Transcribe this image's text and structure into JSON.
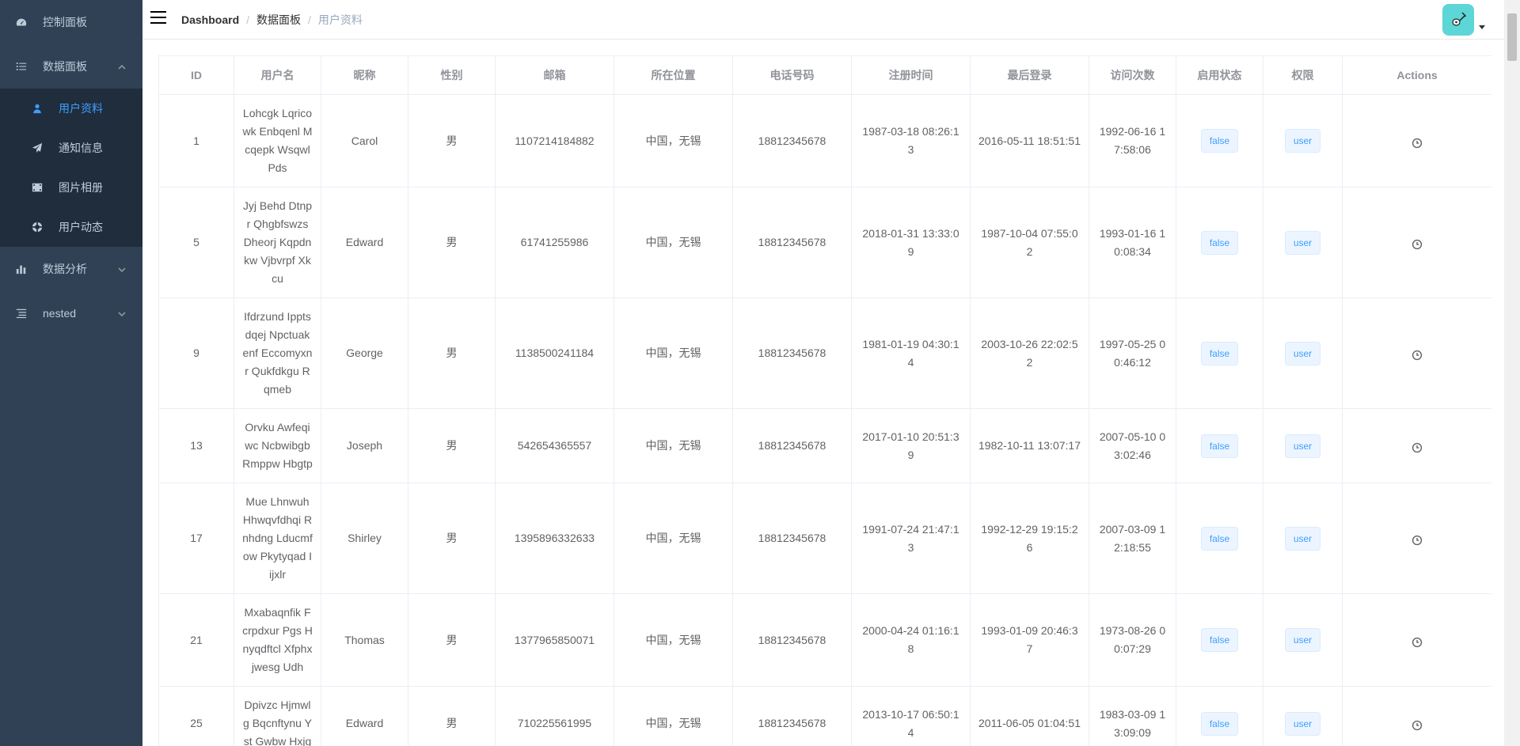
{
  "sidebar": {
    "items": [
      {
        "label": "控制面板",
        "icon": "dashboard-icon"
      },
      {
        "label": "数据面板",
        "icon": "list-icon",
        "expanded": true,
        "children": [
          {
            "label": "用户资料",
            "icon": "user-icon",
            "active": true
          },
          {
            "label": "通知信息",
            "icon": "send-icon"
          },
          {
            "label": "图片相册",
            "icon": "film-icon"
          },
          {
            "label": "用户动态",
            "icon": "lifebuoy-icon"
          }
        ]
      },
      {
        "label": "数据分析",
        "icon": "bar-chart-icon"
      },
      {
        "label": "nested",
        "icon": "nested-list-icon"
      }
    ]
  },
  "navbar": {
    "breadcrumb": [
      "Dashboard",
      "数据面板",
      "用户资料"
    ],
    "separator": "/"
  },
  "table": {
    "columns": [
      "ID",
      "用户名",
      "昵称",
      "性别",
      "邮箱",
      "所在位置",
      "电话号码",
      "注册时间",
      "最后登录",
      "访问次数",
      "启用状态",
      "权限",
      "Actions"
    ],
    "rows": [
      {
        "id": "1",
        "username": "Lohcgk Lqricowk Enbqenl Mcqepk Wsqwl Pds",
        "nickname": "Carol",
        "gender": "男",
        "email": "1107214184882",
        "location": "中国，无锡",
        "phone": "18812345678",
        "registered": "1987-03-18 08:26:13",
        "last_login": "2016-05-11 18:51:51",
        "visits": "1992-06-16 17:58:06",
        "status": "false",
        "role": "user"
      },
      {
        "id": "5",
        "username": "Jyj Behd Dtnpr Qhgbfswzs Dheorj Kqpdnkw Vjbvrpf Xkcu",
        "nickname": "Edward",
        "gender": "男",
        "email": "61741255986",
        "location": "中国，无锡",
        "phone": "18812345678",
        "registered": "2018-01-31 13:33:09",
        "last_login": "1987-10-04 07:55:02",
        "visits": "1993-01-16 10:08:34",
        "status": "false",
        "role": "user"
      },
      {
        "id": "9",
        "username": "Ifdrzund Ippts dqej Npctuakenf Eccomyxnr Qukfdkgu Rqmeb",
        "nickname": "George",
        "gender": "男",
        "email": "1138500241184",
        "location": "中国，无锡",
        "phone": "18812345678",
        "registered": "1981-01-19 04:30:14",
        "last_login": "2003-10-26 22:02:52",
        "visits": "1997-05-25 00:46:12",
        "status": "false",
        "role": "user"
      },
      {
        "id": "13",
        "username": "Orvku Awfeqiwc Ncbwibgb Rmppw Hbgtp",
        "nickname": "Joseph",
        "gender": "男",
        "email": "542654365557",
        "location": "中国，无锡",
        "phone": "18812345678",
        "registered": "2017-01-10 20:51:39",
        "last_login": "1982-10-11 13:07:17",
        "visits": "2007-05-10 03:02:46",
        "status": "false",
        "role": "user"
      },
      {
        "id": "17",
        "username": "Mue Lhnwuh Hhwqvfdhqi Rnhdng Lducmfow Pkytyqad Iijxlr",
        "nickname": "Shirley",
        "gender": "男",
        "email": "1395896332633",
        "location": "中国，无锡",
        "phone": "18812345678",
        "registered": "1991-07-24 21:47:13",
        "last_login": "1992-12-29 19:15:26",
        "visits": "2007-03-09 12:18:55",
        "status": "false",
        "role": "user"
      },
      {
        "id": "21",
        "username": "Mxabaqnfik Fcrpdxur Pgs Hnyqdftcl Xfphxjwesg Udh",
        "nickname": "Thomas",
        "gender": "男",
        "email": "1377965850071",
        "location": "中国，无锡",
        "phone": "18812345678",
        "registered": "2000-04-24 01:16:18",
        "last_login": "1993-01-09 20:46:37",
        "visits": "1973-08-26 00:07:29",
        "status": "false",
        "role": "user"
      },
      {
        "id": "25",
        "username": "Dpivzc Hjmwlg Bqcnftynu Yst Gwbw Hxjg",
        "nickname": "Edward",
        "gender": "男",
        "email": "710225561995",
        "location": "中国，无锡",
        "phone": "18812345678",
        "registered": "2013-10-17 06:50:14",
        "last_login": "2011-06-05 01:04:51",
        "visits": "1983-03-09 13:09:09",
        "status": "false",
        "role": "user"
      }
    ]
  },
  "colors": {
    "sidebar_bg": "#304156",
    "submenu_bg": "#1f2d3d",
    "active": "#409eff",
    "avatar_bg": "#5cd6d6"
  }
}
